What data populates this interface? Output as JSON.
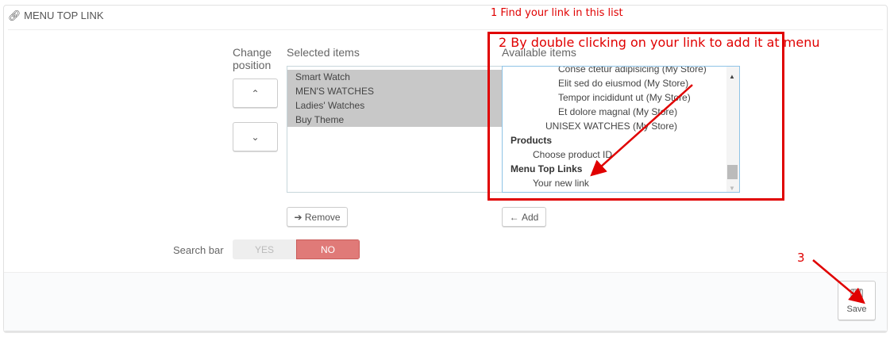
{
  "panel": {
    "title": "MENU TOP LINK",
    "icon": "link-icon"
  },
  "position": {
    "label_line1": "Change",
    "label_line2": "position"
  },
  "selected": {
    "label": "Selected items",
    "items": [
      "Smart Watch",
      "MEN'S WATCHES",
      "Ladies' Watches",
      "Buy Theme"
    ],
    "remove_label": "Remove"
  },
  "available": {
    "label": "Available items",
    "items": [
      "Conse ctetur adipisicing (My Store)",
      "Elit sed do eiusmod (My Store)",
      "Tempor incididunt ut (My Store)",
      "Et dolore magnal (My Store)",
      "UNISEX WATCHES (My Store)"
    ],
    "group_products": "Products",
    "product_item": "Choose product ID",
    "group_links": "Menu Top Links",
    "link_item": "Your new link",
    "add_label": "Add"
  },
  "search_bar": {
    "label": "Search bar",
    "yes": "YES",
    "no": "NO",
    "value": "NO"
  },
  "save_label": "Save",
  "annotations": {
    "step1": "1 Find your link in this list",
    "step2": "2 By double clicking on your link to add it at menu",
    "step3": "3",
    "color": "#e00000"
  }
}
